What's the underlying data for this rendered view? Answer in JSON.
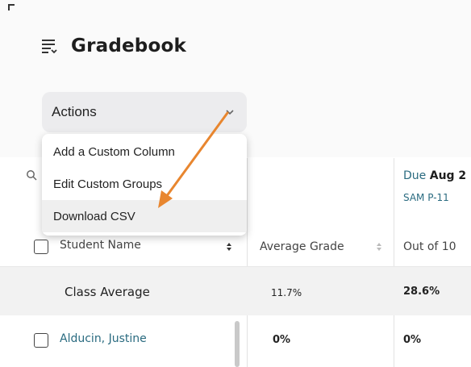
{
  "page": {
    "title": "Gradebook"
  },
  "actions": {
    "label": "Actions",
    "menu": [
      "Add a Custom Column",
      "Edit Custom Groups",
      "Download CSV"
    ]
  },
  "table": {
    "assignment": {
      "due_prefix": "Due",
      "due_date": "Aug 2",
      "code": "SAM P-11"
    },
    "headers": {
      "student": "Student Name",
      "average": "Average Grade",
      "out_of": "Out of 10"
    },
    "class_average": {
      "label": "Class Average",
      "average": "11.7%",
      "assignment": "28.6%"
    },
    "rows": [
      {
        "name": "Alducin, Justine",
        "average": "0%",
        "assignment": "0%"
      }
    ]
  },
  "colors": {
    "accent_link": "#2a6b80",
    "annotation_arrow": "#e8862f"
  }
}
